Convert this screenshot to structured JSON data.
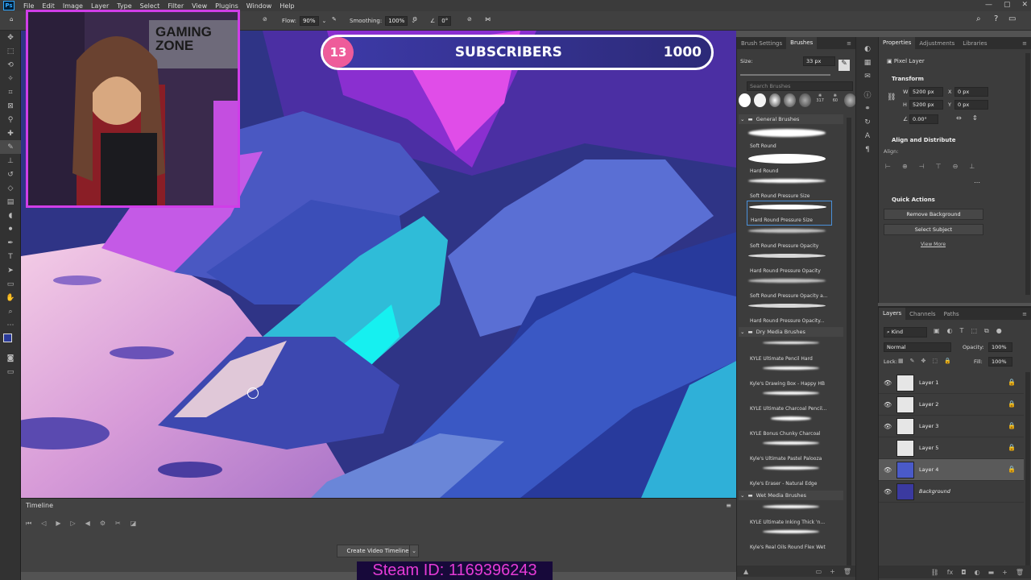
{
  "menu": {
    "app_icon": "Ps",
    "items": [
      "File",
      "Edit",
      "Image",
      "Layer",
      "Type",
      "Select",
      "Filter",
      "View",
      "Plugins",
      "Window",
      "Help"
    ]
  },
  "options_bar": {
    "flow_label": "Flow:",
    "flow_value": "90%",
    "smoothing_label": "Smoothing:",
    "smoothing_value": "100%",
    "angle_value": "0°"
  },
  "overlay": {
    "subscriber_count": "13",
    "subscriber_label": "SUBSCRIBERS",
    "subscriber_goal": "1000",
    "webcam_sign": "GAMING ZONE",
    "steam_id": "Steam ID: 1169396243"
  },
  "timeline": {
    "title": "Timeline",
    "create_button": "Create Video Timeline"
  },
  "brushes_panel": {
    "tabs": [
      "Brush Settings",
      "Brushes"
    ],
    "size_label": "Size:",
    "size_value": "33 px",
    "search_placeholder": "Search Brushes",
    "preset_counts": [
      "317",
      "60"
    ],
    "groups": [
      {
        "name": "General Brushes",
        "brushes": [
          "Soft Round",
          "Hard Round",
          "Soft Round Pressure Size",
          "Hard Round Pressure Size",
          "Soft Round Pressure Opacity",
          "Hard Round Pressure Opacity",
          "Soft Round Pressure Opacity a...",
          "Hard Round Pressure Opacity..."
        ]
      },
      {
        "name": "Dry Media Brushes",
        "brushes": [
          "KYLE Ultimate Pencil Hard",
          "Kyle's Drawing Box - Happy HB",
          "KYLE Ultimate Charcoal Pencil...",
          "KYLE Bonus Chunky Charcoal",
          "Kyle's Ultimate Pastel Palooza",
          "Kyle's Eraser - Natural Edge"
        ]
      },
      {
        "name": "Wet Media Brushes",
        "brushes": [
          "KYLE Ultimate Inking Thick 'n...",
          "Kyle's Real Oils Round Flex Wet"
        ]
      }
    ]
  },
  "properties_panel": {
    "tabs": [
      "Properties",
      "Adjustments",
      "Libraries"
    ],
    "layer_type": "Pixel Layer",
    "transform_title": "Transform",
    "w_label": "W",
    "w_value": "5200 px",
    "h_label": "H",
    "h_value": "5200 px",
    "x_label": "X",
    "x_value": "0 px",
    "y_label": "Y",
    "y_value": "0 px",
    "angle_value": "0.00°",
    "align_title": "Align and Distribute",
    "align_label": "Align:",
    "quick_actions_title": "Quick Actions",
    "remove_bg": "Remove Background",
    "select_subject": "Select Subject",
    "view_more": "View More"
  },
  "layers_panel": {
    "tabs": [
      "Layers",
      "Channels",
      "Paths"
    ],
    "kind_filter": "Kind",
    "blend_mode": "Normal",
    "opacity_label": "Opacity:",
    "opacity_value": "100%",
    "lock_label": "Lock:",
    "fill_label": "Fill:",
    "fill_value": "100%",
    "layers": [
      {
        "name": "Layer 1",
        "visible": true,
        "locked": true,
        "selected": false
      },
      {
        "name": "Layer 2",
        "visible": true,
        "locked": true,
        "selected": false
      },
      {
        "name": "Layer 3",
        "visible": true,
        "locked": true,
        "selected": false
      },
      {
        "name": "Layer 5",
        "visible": false,
        "locked": true,
        "selected": false
      },
      {
        "name": "Layer 4",
        "visible": true,
        "locked": true,
        "selected": true
      },
      {
        "name": "Background",
        "visible": true,
        "locked": false,
        "selected": false
      }
    ]
  },
  "colors": {
    "accent": "#4a90d9",
    "foreground_swatch": "#2a3a9a",
    "overlay_pink": "#ee5c9a",
    "steam_text": "#e63bd6"
  }
}
